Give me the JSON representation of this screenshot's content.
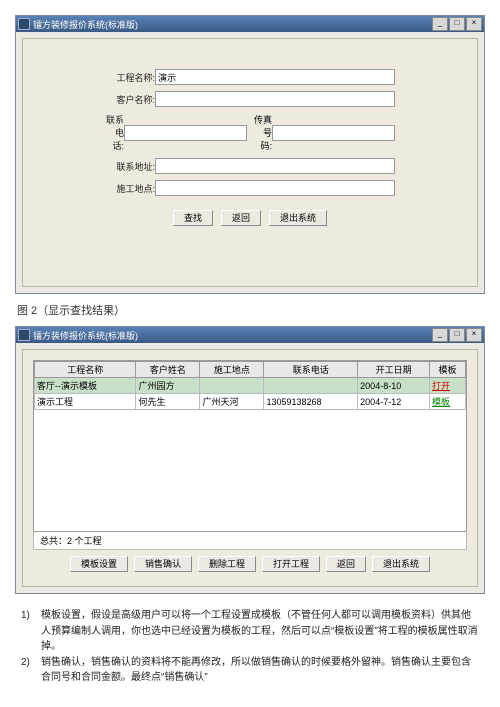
{
  "search_window": {
    "title": "镭方装修报价系统(标准版)",
    "fields": {
      "project_name": {
        "label": "工程名称:",
        "value": "演示"
      },
      "client_name": {
        "label": "客户名称:",
        "value": ""
      },
      "phone": {
        "label": "联系电话:",
        "value": ""
      },
      "pager": {
        "label": "传真号码:",
        "value": ""
      },
      "address": {
        "label": "联系地址:",
        "value": ""
      },
      "site": {
        "label": "施工地点:",
        "value": ""
      }
    },
    "buttons": {
      "search": "查找",
      "back": "返回",
      "exit": "退出系统"
    }
  },
  "caption1": "图 2（显示查找结果）",
  "result_window": {
    "title": "镭方装修报价系统(标准版)",
    "columns": [
      "工程名称",
      "客户姓名",
      "施工地点",
      "联系电话",
      "开工日期",
      "模板"
    ],
    "rows": [
      {
        "project": "客厅--演示模板",
        "client": "广州园方",
        "site": "",
        "phone": "",
        "date": "2004-8-10",
        "action": "打开",
        "action_class": "link-red",
        "selected": true
      },
      {
        "project": "演示工程",
        "client": "何先生",
        "site": "广州天河",
        "phone": "13059138268",
        "date": "2004-7-12",
        "action": "模板",
        "action_class": "link-green",
        "selected": false
      }
    ],
    "status": "总共：2 个工程",
    "buttons": {
      "template": "模板设置",
      "confirm": "销售确认",
      "delete": "删除工程",
      "open": "打开工程",
      "back": "返回",
      "exit": "退出系统"
    }
  },
  "notes": [
    {
      "n": "1)",
      "t": "模板设置，假设是高级用户可以将一个工程设置成模板（不管任何人都可以调用模板资料）供其他人预算编制人调用，你也选中已经设置为模板的工程，然后可以点“模板设置”将工程的模板属性取消掉。"
    },
    {
      "n": "2)",
      "t": "销售确认，销售确认的资料将不能再修改，所以做销售确认的时候要格外留神。销售确认主要包含合同号和合同金额。最终点“销售确认”"
    }
  ]
}
